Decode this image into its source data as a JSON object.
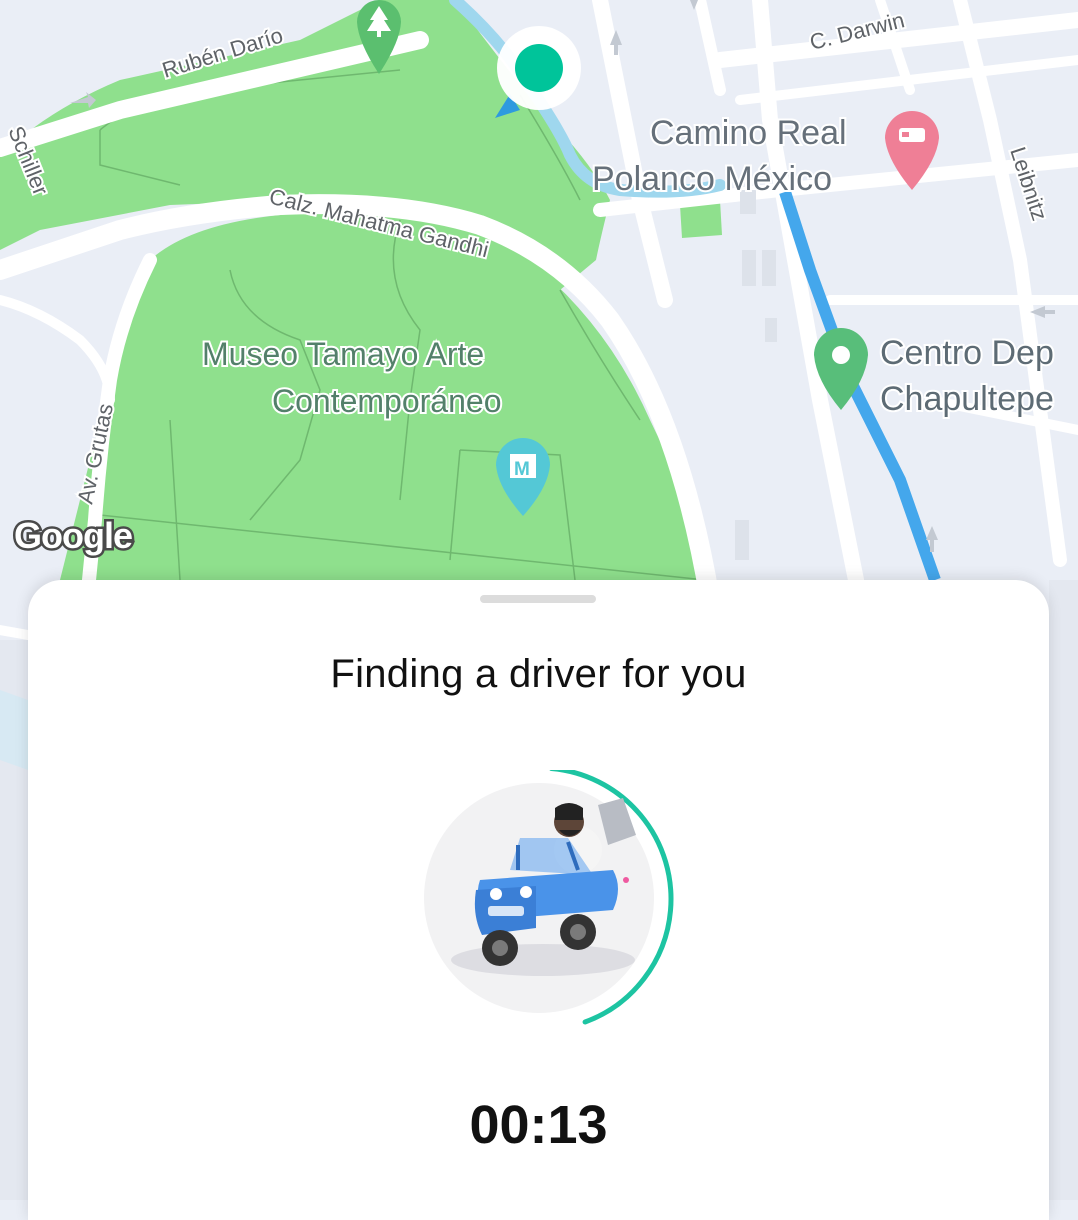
{
  "map": {
    "streets": {
      "ruben_dario": "Rubén Darío",
      "c_darwin": "C. Darwin",
      "schiller": "Schiller",
      "calz_mahatma_gandhi": "Calz. Mahatma Gandhi",
      "leibnitz": "Leibnitz",
      "av_grutas": "Av. Grutas"
    },
    "places": {
      "camino_real_line1": "Camino Real",
      "camino_real_line2": "Polanco México",
      "museo_line1": "Museo Tamayo Arte",
      "museo_line2": "Contemporáneo",
      "centro_line1": "Centro Dep",
      "centro_line2": "Chapultepe"
    },
    "attribution": "Google",
    "colors": {
      "park": "#8fe08d",
      "water": "#9fd7ee",
      "route": "#44a7ec",
      "pickup": "#00c49a",
      "hotel_pin": "#ef7f96"
    }
  },
  "sheet": {
    "title": "Finding a driver for you",
    "timer": "00:13",
    "progress_fraction": 0.43,
    "accent_color": "#1dc4a2"
  }
}
